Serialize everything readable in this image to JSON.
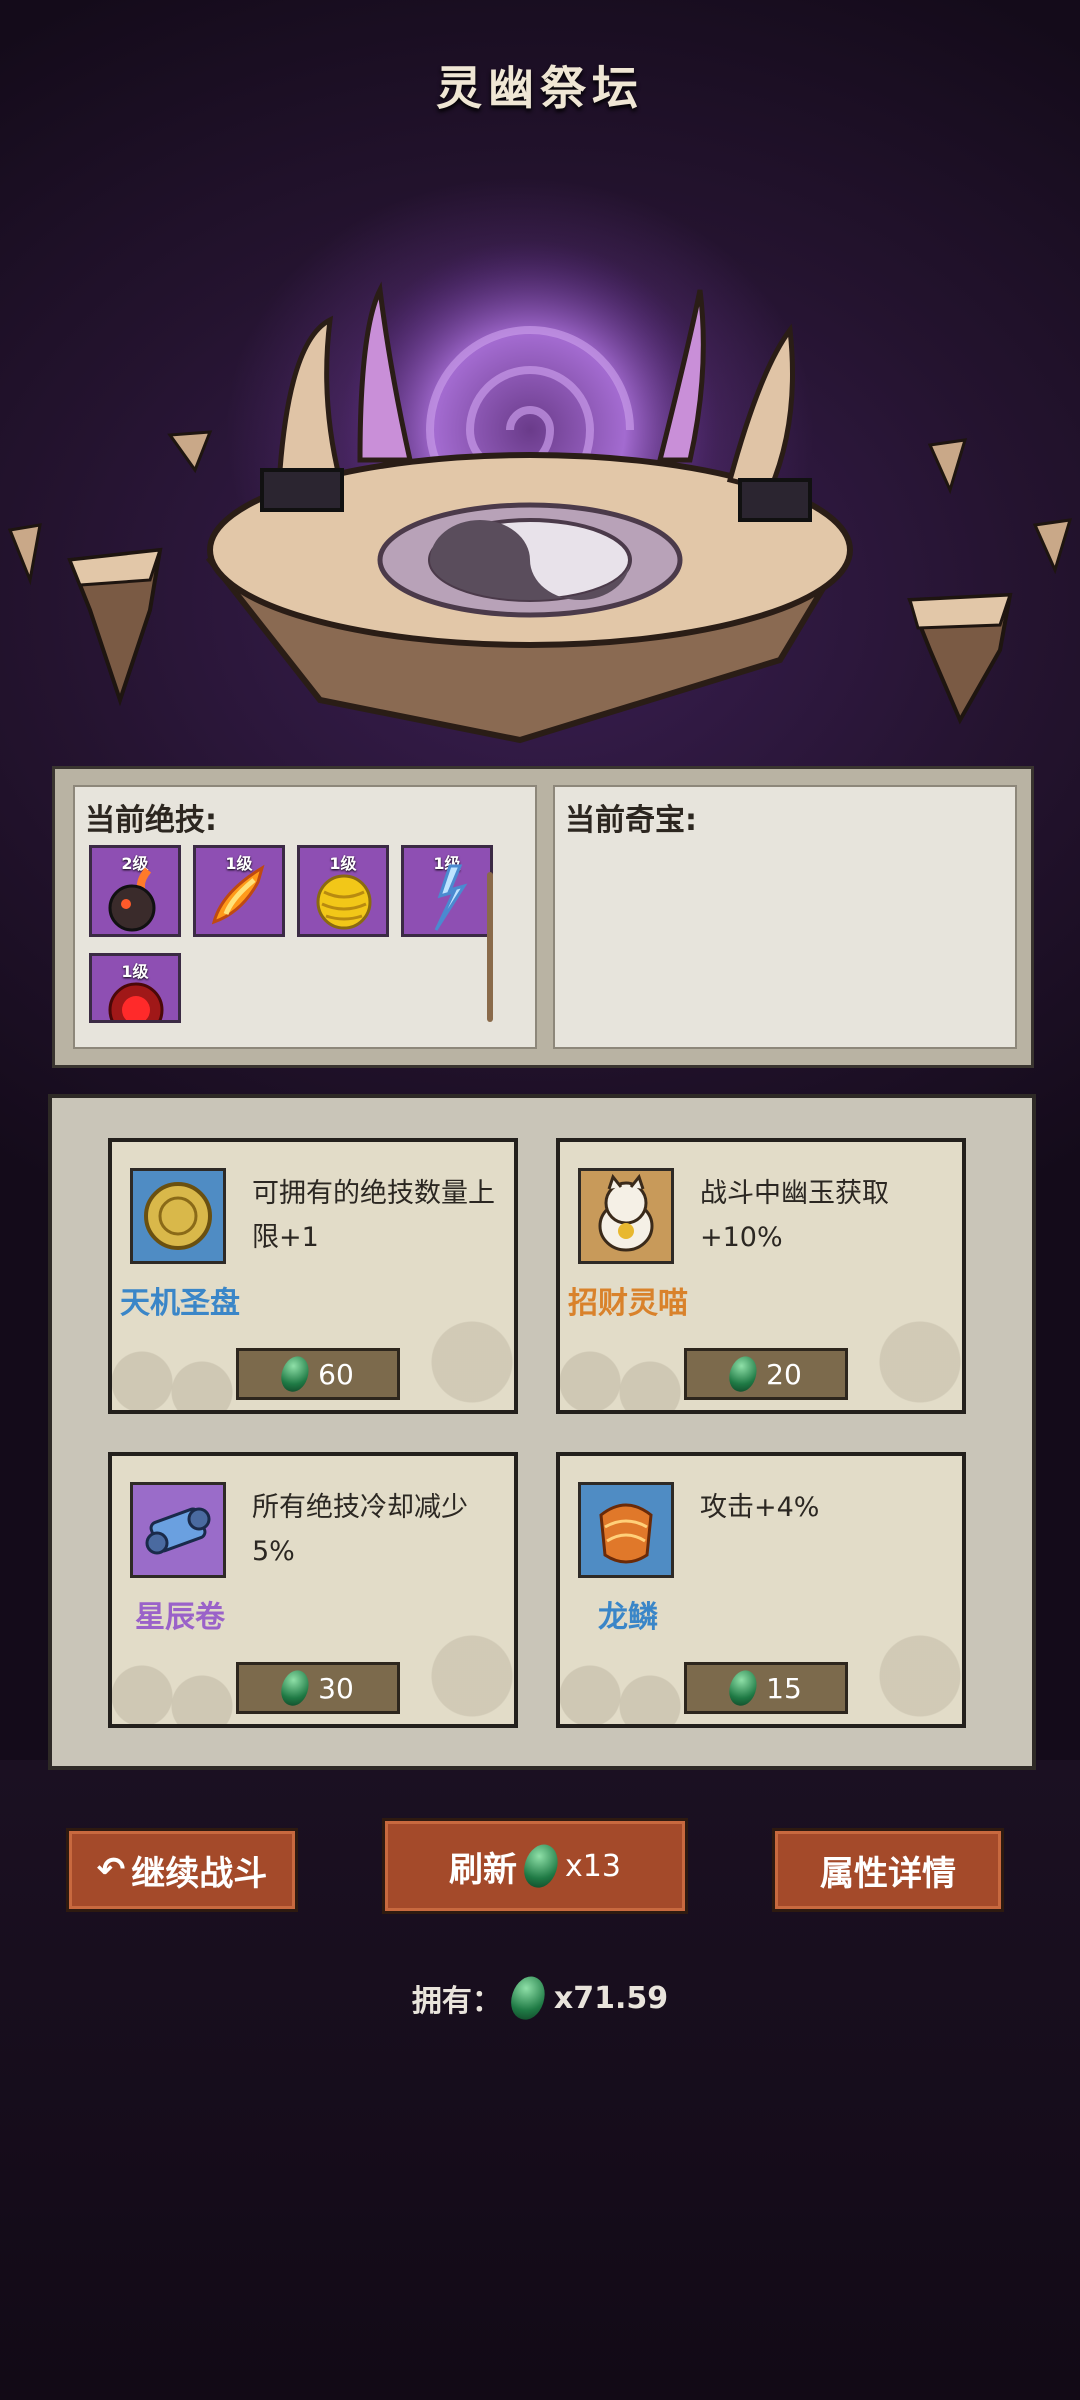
{
  "title": "灵幽祭坛",
  "current_skills": {
    "label": "当前绝技:",
    "items": [
      {
        "level": "2级",
        "icon": "meteor-icon"
      },
      {
        "level": "1级",
        "icon": "fire-slash-icon"
      },
      {
        "level": "1级",
        "icon": "yellow-orb-icon"
      },
      {
        "level": "1级",
        "icon": "lightning-icon"
      },
      {
        "level": "1级",
        "icon": "red-vortex-icon"
      }
    ]
  },
  "current_treasures": {
    "label": "当前奇宝:"
  },
  "shop": {
    "items": [
      {
        "name": "天机圣盘",
        "desc": "可拥有的绝技数量上限+1",
        "price": "60",
        "name_color": "#3a86c8",
        "icon": "golden-disc-icon"
      },
      {
        "name": "招财灵喵",
        "desc": "战斗中幽玉获取+10%",
        "price": "20",
        "name_color": "#d9822b",
        "icon": "lucky-cat-icon"
      },
      {
        "name": "星辰卷",
        "desc": "所有绝技冷却减少5%",
        "price": "30",
        "name_color": "#9a62c9",
        "icon": "scroll-icon"
      },
      {
        "name": "龙鳞",
        "desc": "攻击+4%",
        "price": "15",
        "name_color": "#3a86c8",
        "icon": "dragon-scale-icon"
      }
    ]
  },
  "buttons": {
    "continue": "继续战斗",
    "refresh": "刷新",
    "refresh_cost": "x13",
    "attributes": "属性详情"
  },
  "owned": {
    "label": "拥有：",
    "amount": "x71.59"
  }
}
